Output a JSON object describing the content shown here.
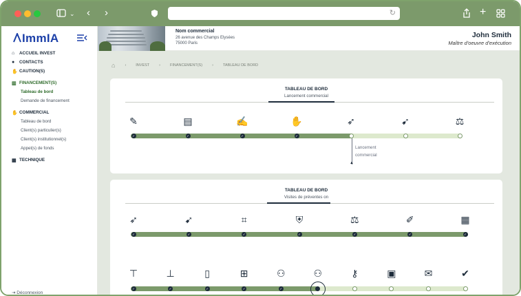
{
  "app": {
    "logo": "ImmIA",
    "logout_label": "Déconnexion"
  },
  "sidebar": {
    "items": [
      {
        "icon": "home-icon",
        "label": "ACCUEIL INVEST",
        "active": false
      },
      {
        "icon": "person-icon",
        "label": "CONTACTS",
        "active": false
      },
      {
        "icon": "handshake-icon",
        "label": "CAUTION(S)",
        "active": false
      },
      {
        "icon": "chart-icon",
        "label": "FINANCEMENT(S)",
        "active": true
      },
      {
        "icon": "handshake-icon",
        "label": "COMMERCIAL",
        "active": false
      },
      {
        "icon": "building-icon",
        "label": "TECHNIQUE",
        "active": false
      }
    ],
    "financement_sub": [
      {
        "label": "Tableau de bord",
        "active": true
      },
      {
        "label": "Demande de financement",
        "active": false
      }
    ],
    "commercial_sub": [
      {
        "label": "Tableau de bord"
      },
      {
        "label": "Client(s) particulier(s)"
      },
      {
        "label": "Client(s) institutionnel(s)"
      },
      {
        "label": "Appel(s) de fonds"
      }
    ]
  },
  "header": {
    "name": "Nom commercial",
    "address_line1": "26 avenue des Champs Elysées",
    "address_line2": "75000 Paris",
    "user_name": "John Smith",
    "user_role": "Maître d'oeuvre d'exécution"
  },
  "breadcrumb": {
    "items": [
      "INVEST",
      "FINANCEMENT(S)",
      "TABLEAU DE BORD"
    ]
  },
  "card1": {
    "title": "TABLEAU DE BORD",
    "subtitle": "Lancement commercial",
    "marker_line1": "Lancement",
    "marker_line2": "commercial",
    "steps": [
      {
        "icon": "pen-icon",
        "done": true
      },
      {
        "icon": "money-stack-icon",
        "done": true
      },
      {
        "icon": "signature-icon",
        "done": true
      },
      {
        "icon": "handshake-icon",
        "done": true
      },
      {
        "icon": "rocket-icon",
        "done": false
      },
      {
        "icon": "rocket-check-icon",
        "done": false
      },
      {
        "icon": "scales-icon",
        "done": false
      }
    ],
    "progress": 0.7
  },
  "card2": {
    "title": "TABLEAU DE BORD",
    "subtitle": "Visites de préventes on",
    "row1": [
      {
        "icon": "rocket-icon",
        "done": true
      },
      {
        "icon": "rocket-check-icon",
        "done": true
      },
      {
        "icon": "plan-icon",
        "done": true
      },
      {
        "icon": "shield-check-icon",
        "done": true
      },
      {
        "icon": "scales-icon",
        "done": true
      },
      {
        "icon": "edit-icon",
        "done": true
      },
      {
        "icon": "grid-icon",
        "done": true
      }
    ],
    "row2": [
      {
        "icon": "crane-icon",
        "done": true
      },
      {
        "icon": "foundation-icon",
        "done": true
      },
      {
        "icon": "tower-icon",
        "done": true
      },
      {
        "icon": "window-icon",
        "done": true
      },
      {
        "icon": "people-icon",
        "done": true
      },
      {
        "icon": "people-icon",
        "done": true
      },
      {
        "icon": "key-icon",
        "done": false
      },
      {
        "icon": "calendar-icon",
        "done": false
      },
      {
        "icon": "mail-icon",
        "done": false
      },
      {
        "icon": "check-circle-icon",
        "done": false
      }
    ]
  }
}
